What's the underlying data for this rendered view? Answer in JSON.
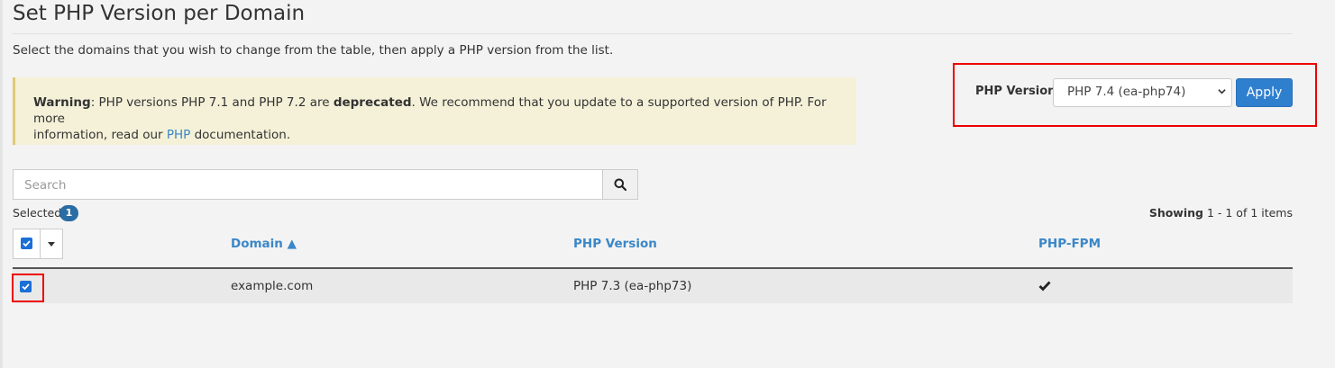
{
  "page": {
    "title": "Set PHP Version per Domain",
    "intro": "Select the domains that you wish to change from the table, then apply a PHP version from the list."
  },
  "warning": {
    "label": "Warning",
    "text_before": ": PHP versions PHP 7.1 and PHP 7.2 are ",
    "bold": "deprecated",
    "text_after": ". We recommend that you update to a supported version of PHP. For more",
    "line2_before": "information, read our ",
    "link": "PHP",
    "line2_after": " documentation."
  },
  "php_version": {
    "label": "PHP Version",
    "selected": "PHP 7.4 (ea-php74)",
    "apply_label": "Apply"
  },
  "search": {
    "placeholder": "Search",
    "icon": "search-icon"
  },
  "selection": {
    "label": "Selected",
    "count": "1"
  },
  "showing": {
    "label": "Showing",
    "range": " 1 - 1 of 1 items"
  },
  "table": {
    "columns": [
      {
        "label": "Domain ▲"
      },
      {
        "label": "PHP Version"
      },
      {
        "label": "PHP-FPM"
      }
    ],
    "rows": [
      {
        "checked": true,
        "domain": "example.com",
        "php_version": "PHP 7.3 (ea-php73)",
        "php_fpm": "check-icon"
      }
    ]
  },
  "colors": {
    "accent": "#2f7fcf",
    "link": "#3a87c8",
    "warning_bg": "#f4f1d8",
    "highlight_red": "#e00000",
    "badge": "#2a6da4"
  }
}
